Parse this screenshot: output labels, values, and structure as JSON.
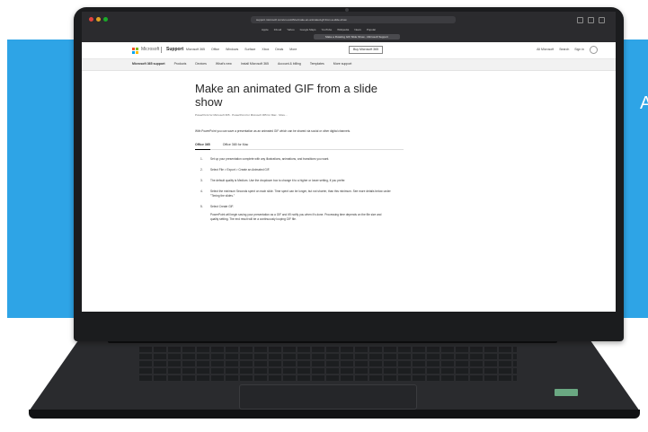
{
  "colors": {
    "banner_blue": "#2ea4e6",
    "laptop_body": "#1b1c1e",
    "ms_red": "#f25022",
    "ms_green": "#7fba00",
    "ms_blue": "#00a4ef",
    "ms_yellow": "#ffb900"
  },
  "banner": {
    "letter": "A"
  },
  "browser": {
    "url": "support.microsoft.com/en-us/office/make-an-animated-gif-from-a-slide-show",
    "bookmarks": [
      "Apple",
      "iCloud",
      "Yahoo",
      "Google Maps",
      "YouTube",
      "Wikipedia",
      "News",
      "Popular"
    ],
    "reading_list": "Make a Rotating GIF Slide Show - Microsoft Support"
  },
  "ms_header": {
    "brand": "Microsoft",
    "support": "Support",
    "nav": [
      "Microsoft 365",
      "Office",
      "Windows",
      "Surface",
      "Xbox",
      "Deals",
      "More"
    ],
    "buy_button": "Buy Microsoft 365",
    "right": [
      "All Microsoft",
      "Search",
      "Sign in"
    ]
  },
  "sub_nav": [
    "Microsoft 365 support",
    "Products",
    "Devices",
    "What's new",
    "Install Microsoft 365",
    "Account & billing",
    "Templates",
    "More support"
  ],
  "article": {
    "title": "Make an animated GIF from a slide show",
    "applies_to": "PowerPoint for Microsoft 365 · PowerPoint for Microsoft 365 for Mac · More...",
    "intro": "With PowerPoint you can save a presentation as an animated GIF which can be shared via social or other digital channels.",
    "tabs": [
      "Office 365",
      "Office 365 for Mac"
    ],
    "steps": [
      {
        "num": "1.",
        "text": "Set up your presentation complete with any illustrations, animations, and transitions you want."
      },
      {
        "num": "2.",
        "text": "Select File > Export > Create an Animated GIF."
      },
      {
        "num": "3.",
        "text": "The default quality is Medium. Use the dropdown box to change it to a higher or lower setting, if you prefer."
      },
      {
        "num": "4.",
        "text": "Select the minimum Seconds spent on each slide. Time spent can be longer, but not shorter, than this minimum. See more details below under \"Timing the slides.\""
      },
      {
        "num": "5.",
        "text": "Select Create GIF."
      }
    ],
    "step5_detail": "PowerPoint will begin saving your presentation as a GIF and it'll notify you when it's done. Processing time depends on the file size and quality setting. The end result will be a continuously looping GIF file."
  }
}
